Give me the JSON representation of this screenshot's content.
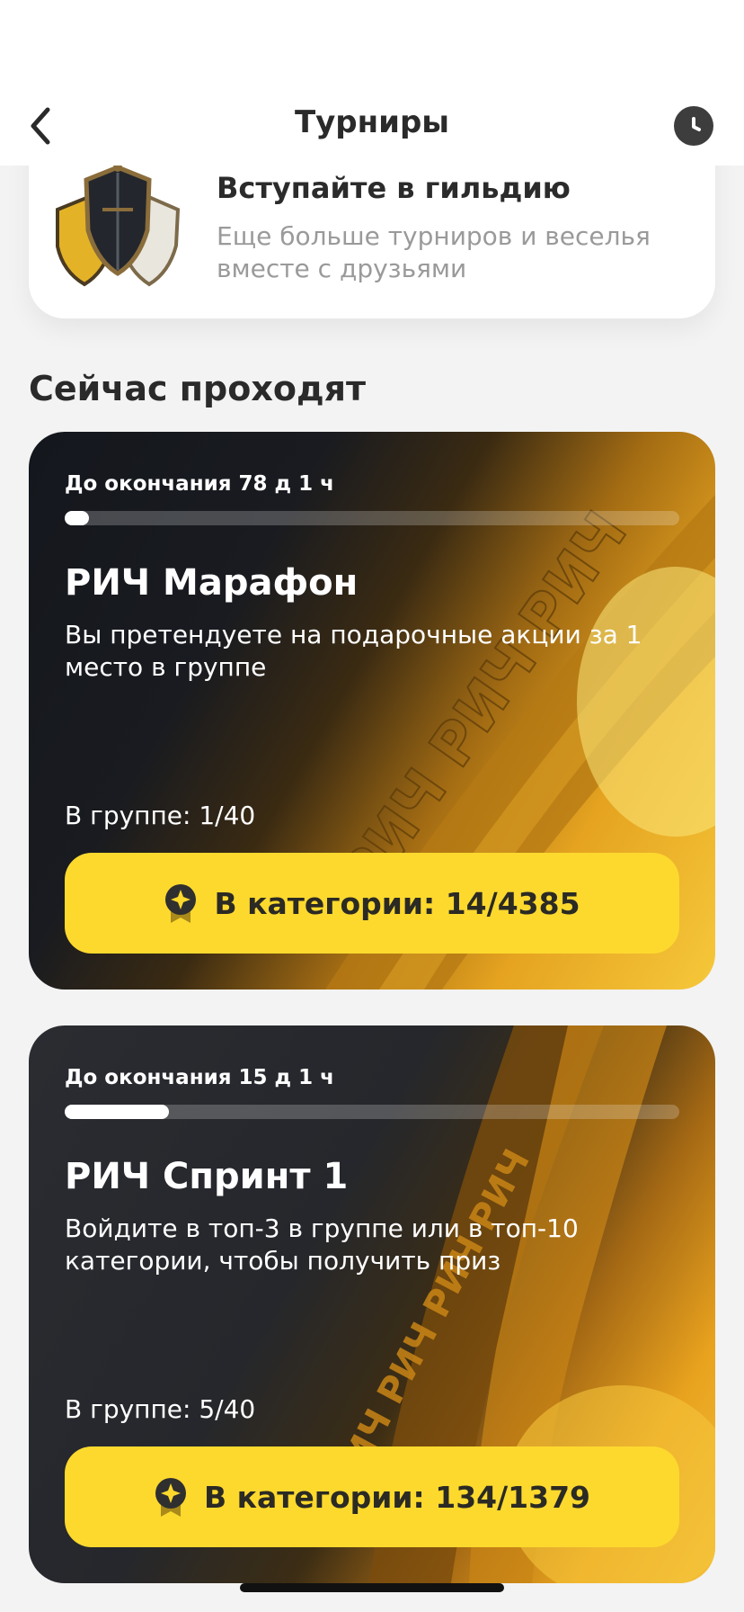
{
  "header": {
    "title": "Турниры",
    "back_icon": "chevron-left-icon",
    "history_icon": "clock-icon"
  },
  "guild": {
    "title": "Вступайте в гильдию",
    "subtitle": "Еще больше турниров и веселья вместе с друзьями",
    "image": "guild-shields-icon"
  },
  "section": {
    "title": "Сейчас проходят"
  },
  "tournaments": [
    {
      "countdown": "До окончания 78 д 1 ч",
      "progress_fraction": 0.04,
      "title": "РИЧ Марафон",
      "description": "Вы претендуете на подарочные акции за 1 место в группе",
      "group": "В группе: 1/40",
      "button_label": "В категории: 14/4385",
      "button_icon": "medal-icon",
      "art_text": "РИЧ РИЧ РИЧ"
    },
    {
      "countdown": "До окончания 15 д 1 ч",
      "progress_fraction": 0.17,
      "title": "РИЧ Спринт 1",
      "description": "Войдите в топ-3 в группе или в топ-10 категории, чтобы получить приз",
      "group": "В группе: 5/40",
      "button_label": "В категории: 134/1379",
      "button_icon": "medal-icon",
      "art_text": "РИЧ РИЧ РИЧ РИЧ"
    }
  ],
  "colors": {
    "accent_yellow": "#fdd92e",
    "card_dark": "#14171d",
    "text_dark": "#2a2a2a",
    "text_muted": "#9a9a9a"
  }
}
